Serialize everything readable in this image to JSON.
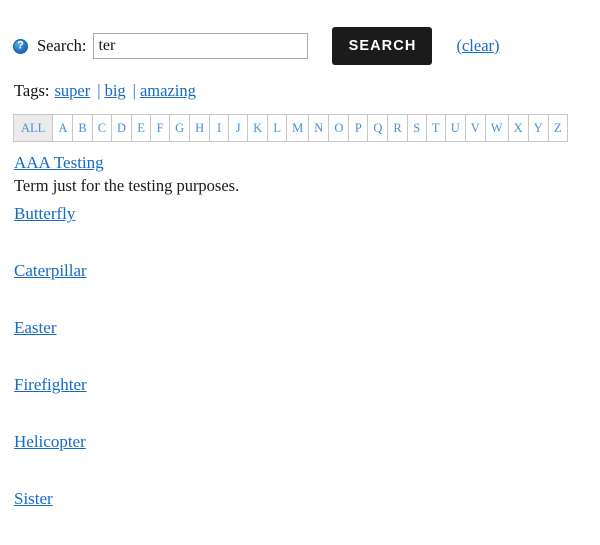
{
  "search": {
    "help_icon": "help-circle-icon",
    "label": "Search:",
    "value": "ter",
    "placeholder": "",
    "button_label": "SEARCH",
    "clear_label": "(clear)"
  },
  "tags": {
    "label": "Tags:",
    "separator": "|",
    "items": [
      {
        "label": "super"
      },
      {
        "label": "big"
      },
      {
        "label": "amazing"
      }
    ]
  },
  "alphabet": {
    "selected": "ALL",
    "items": [
      "ALL",
      "A",
      "B",
      "C",
      "D",
      "E",
      "F",
      "G",
      "H",
      "I",
      "J",
      "K",
      "L",
      "M",
      "N",
      "O",
      "P",
      "Q",
      "R",
      "S",
      "T",
      "U",
      "V",
      "W",
      "X",
      "Y",
      "Z"
    ]
  },
  "results": [
    {
      "term": "AAA Testing",
      "definition": "Term just for the testing purposes."
    },
    {
      "term": "Butterfly",
      "definition": ""
    },
    {
      "term": "Caterpillar",
      "definition": ""
    },
    {
      "term": "Easter",
      "definition": ""
    },
    {
      "term": "Firefighter",
      "definition": ""
    },
    {
      "term": "Helicopter",
      "definition": ""
    },
    {
      "term": "Sister",
      "definition": ""
    }
  ],
  "colors": {
    "link": "#1569c7",
    "alpha_letter": "#4a90d9",
    "button_bg": "#1b1b1b",
    "selected_cell_bg": "#ebebeb",
    "text": "#1a1a1a"
  }
}
